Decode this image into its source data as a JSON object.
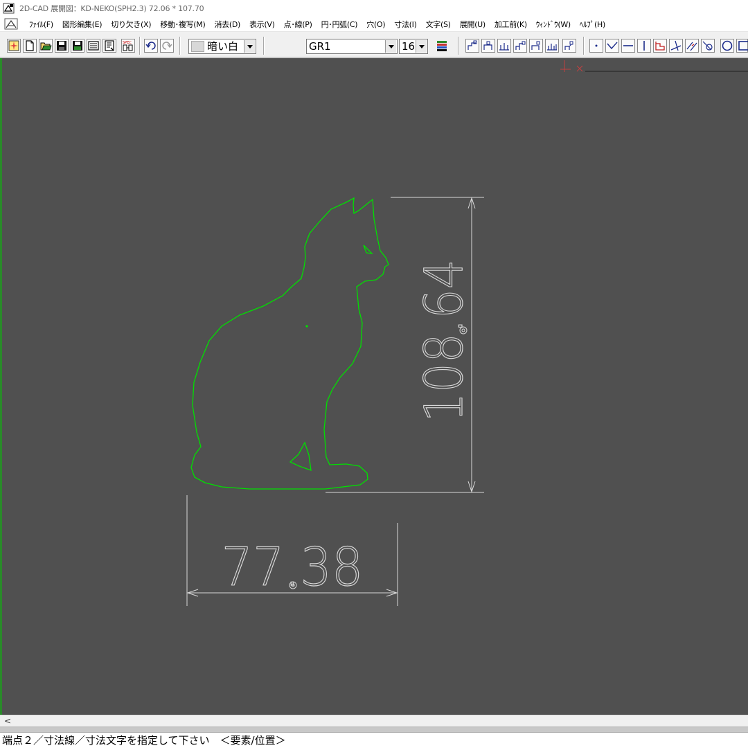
{
  "window": {
    "title": "2D-CAD 展開図：KD-NEKO(SPH2.3) 72.06 * 107.70"
  },
  "menu": {
    "items": [
      "ﾌｧｲﾙ(F)",
      "図形編集(E)",
      "切り欠き(X)",
      "移動･複写(M)",
      "消去(D)",
      "表示(V)",
      "点･線(P)",
      "円･円弧(C)",
      "穴(O)",
      "寸法(I)",
      "文字(S)",
      "展開(U)",
      "加工前(K)",
      "ｳｨﾝﾄﾞｳ(W)",
      "ﾍﾙﾌﾟ(H)"
    ]
  },
  "toolbar": {
    "color_select": "暗い白",
    "group_select": "GR1",
    "size_select": "16",
    "spec_icon_label": "SPEC"
  },
  "icons": {
    "app": "cad-app-icon",
    "document": "cad-document-icon",
    "file_buttons": [
      "new-sparkle-icon",
      "new-file-icon",
      "open-folder-icon",
      "save-disk-icon",
      "save-as-disk-icon",
      "print-icon",
      "print-preview-icon",
      "spec-icon"
    ],
    "history_buttons": [
      "undo-icon",
      "redo-icon"
    ],
    "layer_button": "layer-stack-icon",
    "dimension_buttons": [
      "dimension-1-icon",
      "dimension-2-icon",
      "dimension-3-icon",
      "dimension-4-icon",
      "dimension-5-icon",
      "dimension-6-icon",
      "dimension-7-icon"
    ],
    "draw_buttons": [
      "point-icon",
      "check-line-icon",
      "horizontal-line-icon",
      "vertical-line-icon",
      "polyline-icon",
      "angle-line-icon",
      "parallel-line-icon",
      "tangent-line-icon",
      "circle-icon",
      "rectangle-icon"
    ]
  },
  "drawing": {
    "outline_color": "#00e000",
    "dimension_color": "#d8d8d8",
    "background_color": "#505050",
    "dimension_width": "77.38",
    "dimension_height": "108.64"
  },
  "statusbar": {
    "message": "端点２／寸法線／寸法文字を指定して下さい　＜要素/位置＞"
  }
}
